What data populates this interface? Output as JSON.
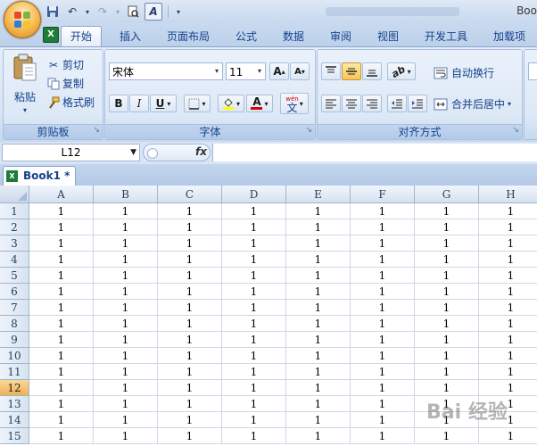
{
  "window": {
    "title": "Boo"
  },
  "tabs": [
    "开始",
    "插入",
    "页面布局",
    "公式",
    "数据",
    "审阅",
    "视图",
    "开发工具",
    "加载项"
  ],
  "active_tab_index": 0,
  "clipboard": {
    "paste": "粘贴",
    "cut": "剪切",
    "copy": "复制",
    "format_painter": "格式刷",
    "label": "剪贴板"
  },
  "font": {
    "name": "宋体",
    "size": "11",
    "bold": "B",
    "italic": "I",
    "underline": "U",
    "font_color_glyph": "A",
    "grow": "A",
    "shrink": "A",
    "phonetic": "wén",
    "phonetic_char": "文",
    "label": "字体"
  },
  "alignment": {
    "wrap_text": "自动换行",
    "merge_center": "合并后居中",
    "label": "对齐方式"
  },
  "formula_bar": {
    "name_box": "L12",
    "fx": "fx",
    "formula": ""
  },
  "workbook": {
    "tab_name": "Book1 *"
  },
  "sheet": {
    "columns": [
      "A",
      "B",
      "C",
      "D",
      "E",
      "F",
      "G",
      "H"
    ],
    "rows": [
      "1",
      "2",
      "3",
      "4",
      "5",
      "6",
      "7",
      "8",
      "9",
      "10",
      "11",
      "12",
      "13",
      "14",
      "15"
    ],
    "selected_row": "12",
    "cell_value": "1"
  },
  "colors": {
    "accent": "#15428b",
    "selected_header": "#f1b04f"
  },
  "watermark": "Bai 经验"
}
